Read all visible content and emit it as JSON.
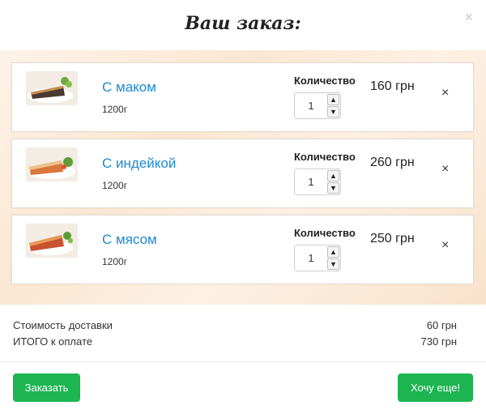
{
  "modal": {
    "title": "Ваш заказ:",
    "close_icon": "×"
  },
  "items": [
    {
      "name": "С маком",
      "weight": "1200г",
      "qty_label": "Количество",
      "qty": "1",
      "price": "160 грн",
      "remove": "×",
      "image": "pie-poppy"
    },
    {
      "name": "С индейкой",
      "weight": "1200г",
      "qty_label": "Количество",
      "qty": "1",
      "price": "260 грн",
      "remove": "×",
      "image": "pie-turkey"
    },
    {
      "name": "С мясом",
      "weight": "1200г",
      "qty_label": "Количество",
      "qty": "1",
      "price": "250 грн",
      "remove": "×",
      "image": "pie-meat"
    }
  ],
  "summary": {
    "delivery_label": "Стоимость доставки",
    "delivery_value": "60 грн",
    "total_label": "ИТОГО к оплате",
    "total_value": "730 грн"
  },
  "buttons": {
    "order": "Заказать",
    "more": "Хочу еще!"
  },
  "colors": {
    "accent": "#1cb552",
    "link": "#1a8ad4"
  }
}
